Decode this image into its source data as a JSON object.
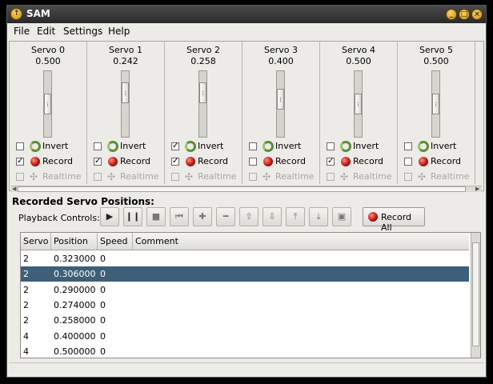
{
  "window": {
    "title": "SAM"
  },
  "menu": [
    "File",
    "Edit",
    "Settings",
    "Help"
  ],
  "servos": [
    {
      "name": "Servo 0",
      "value": "0.500",
      "level": 0.5,
      "invert": false,
      "record": true,
      "realtime": false
    },
    {
      "name": "Servo 1",
      "value": "0.242",
      "level": 0.242,
      "invert": false,
      "record": true,
      "realtime": false
    },
    {
      "name": "Servo 2",
      "value": "0.258",
      "level": 0.258,
      "invert": true,
      "record": true,
      "realtime": false
    },
    {
      "name": "Servo 3",
      "value": "0.400",
      "level": 0.4,
      "invert": false,
      "record": false,
      "realtime": false
    },
    {
      "name": "Servo 4",
      "value": "0.500",
      "level": 0.5,
      "invert": false,
      "record": true,
      "realtime": false
    },
    {
      "name": "Servo 5",
      "value": "0.500",
      "level": 0.5,
      "invert": false,
      "record": false,
      "realtime": false
    }
  ],
  "labels": {
    "invert": "Invert",
    "record": "Record",
    "realtime": "Realtime"
  },
  "recorded": {
    "title": "Recorded Servo Positions:",
    "playback_label": "Playback Controls:",
    "record_all": "Record All",
    "columns": [
      "Servo",
      "Position",
      "Speed",
      "Comment"
    ],
    "rows": [
      [
        "2",
        "0.323000",
        "0",
        ""
      ],
      [
        "2",
        "0.306000",
        "0",
        ""
      ],
      [
        "2",
        "0.290000",
        "0",
        ""
      ],
      [
        "2",
        "0.274000",
        "0",
        ""
      ],
      [
        "2",
        "0.258000",
        "0",
        ""
      ],
      [
        "4",
        "0.400000",
        "0",
        ""
      ],
      [
        "4",
        "0.500000",
        "0",
        ""
      ]
    ],
    "selected_row": 1
  },
  "toolbar_icons": [
    "play-icon",
    "pause-icon",
    "stop-icon",
    "skip-back-icon",
    "add-icon",
    "remove-icon",
    "move-up-icon",
    "move-down-icon",
    "move-top-icon",
    "move-bottom-icon",
    "save-icon"
  ],
  "colors": {
    "selection": "#3d5f78",
    "record_red": "#b41008",
    "titlebar": "#2a2a2a"
  }
}
